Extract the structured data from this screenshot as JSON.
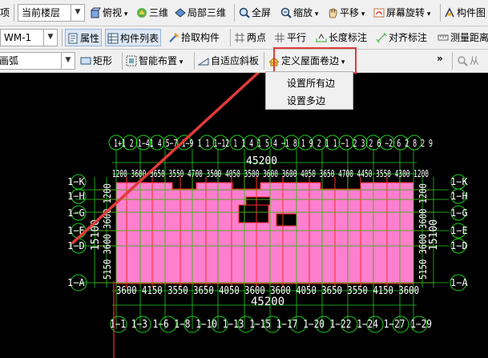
{
  "toolbar1": {
    "left_fragment": "项",
    "floor_combo": "当前楼层",
    "top_view": "俯视",
    "view_3d": "三维",
    "partial_3d": "局部三维",
    "fullscreen": "全屏",
    "zoom": "缩放",
    "pan": "平移",
    "rotate": "屏幕旋转",
    "component": "构件图"
  },
  "toolbar2": {
    "component_select": "WM-1",
    "properties": "属性",
    "component_list": "构件列表",
    "pick_component": "拾取构件",
    "two_point": "两点",
    "parallel": "平行",
    "length_dim": "长度标注",
    "align_dim": "对齐标注",
    "measure": "测量距离"
  },
  "toolbar3": {
    "arc_combo": "画弧",
    "rectangle": "矩形",
    "smart_layout": "智能布置",
    "adaptive_slope": "自适应斜板",
    "define_roof_edge": "定义屋面卷边",
    "overflow": "»",
    "from_fragment": "从"
  },
  "popup_menu": [
    "设置所有边",
    "设置多边"
  ],
  "drawing": {
    "top_axis_labels": "1+1 2 1−41 4 5−7 1−9 1 1 1−12 1 1 4 1 5 4 −1 8 1 9 2 1 1 −1 2 3 2 6 −2 6 2 8 2 9",
    "top_dims_row": "1200 3600 3650 3550 4700 3500 4050 3500 3600 3600 4050 3650 4700 4450 3550 4300 1200",
    "top_total": "45200",
    "bottom_dims_row": "3600 4150 3550 3650 4050 3600 3600 4050 3650 3550 4150 3600",
    "bottom_total": "45200",
    "bottom_axis_labels": "1−1 1−3 1−6 1−8 1−10 1−13 1−15 1−17 1−20 1−22 1−24 1−27 1−29",
    "left_axis_labels": [
      "1−K",
      "1−H",
      "1−G",
      "1−E",
      "1−D",
      "1−A"
    ],
    "right_axis_labels": [
      "1−K",
      "1−H",
      "1−G",
      "1−E",
      "1−D",
      "1−A"
    ],
    "left_dim": "15100",
    "right_dim": "15100",
    "left_dims_vertical": "5150 3600 3600 1200",
    "right_dims_vertical": "5150 3600 3600 1200",
    "colors": {
      "slab": "#ff7fcf",
      "axis": "#1fd01f",
      "beam": "#ff2a2a",
      "text": "#ffffff",
      "callout": "#e03a3a"
    }
  }
}
